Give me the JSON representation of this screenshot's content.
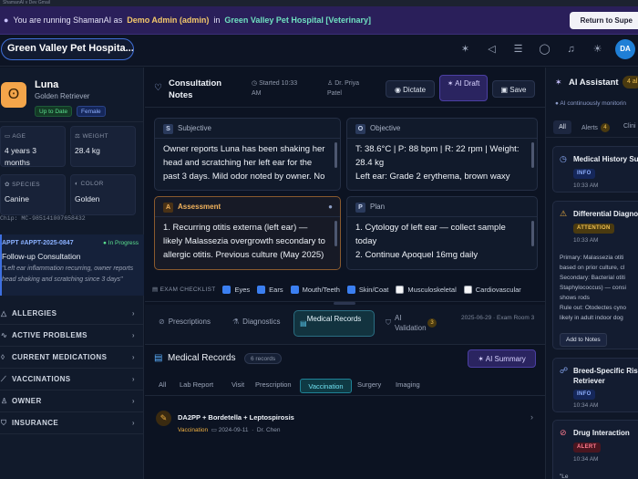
{
  "chrome": {
    "text": "ShamanAI v Dev    Gmail"
  },
  "banner": {
    "prefix": "You are running ShamanAI as",
    "user": "Demo Admin (admin)",
    "in": "in",
    "clinic": "Green Valley Pet Hospital [Veterinary]",
    "return": "Return to Supe"
  },
  "header": {
    "clinic_selector": "Green Valley Pet Hospita...",
    "avatar": "DA"
  },
  "pet": {
    "name": "Luna",
    "breed": "Golden Retriever",
    "status": "Up to Date",
    "sex": "Female",
    "stats": [
      {
        "label": "AGE",
        "value": "4 years 3 months"
      },
      {
        "label": "WEIGHT",
        "value": "28.4 kg"
      },
      {
        "label": "SPECIES",
        "value": "Canine"
      },
      {
        "label": "COLOR",
        "value": "Golden"
      }
    ],
    "chip": "Chip: MC-985141007658432"
  },
  "appointment": {
    "id": "APPT #APPT-2025-0847",
    "status": "● In Progress",
    "title": "Follow-up Consultation",
    "note": "\"Left ear inflammation recurring, owner reports head shaking and scratching since 3 days\""
  },
  "sections": [
    "ALLERGIES",
    "ACTIVE PROBLEMS",
    "CURRENT MEDICATIONS",
    "VACCINATIONS",
    "OWNER",
    "INSURANCE"
  ],
  "consult": {
    "title": "Consultation Notes",
    "started": "Started 10:33 AM",
    "doctor": "Dr. Priya Patel",
    "dictate": "Dictate",
    "ai_draft": "AI Draft",
    "save": "Save"
  },
  "soap": {
    "subjective": {
      "letter": "S",
      "title": "Subjective",
      "body": "Owner reports Luna has been shaking her head and scratching her left ear for the past 3 days. Mild odor noted by owner. No"
    },
    "objective": {
      "letter": "O",
      "title": "Objective",
      "body": "T: 38.6°C | P: 88 bpm | R: 22 rpm | Weight: 28.4 kg\nLeft ear: Grade 2 erythema, brown waxy"
    },
    "assessment": {
      "letter": "A",
      "title": "Assessment",
      "body": "1. Recurring otitis externa (left ear) — likely Malassezia overgrowth secondary to allergic otitis. Previous culture (May 2025)"
    },
    "plan": {
      "letter": "P",
      "title": "Plan",
      "body": "1. Cytology of left ear — collect sample today\n2. Continue Apoquel 16mg daily"
    }
  },
  "exam": {
    "label": "EXAM CHECKLIST",
    "items": [
      {
        "label": "Eyes",
        "checked": true
      },
      {
        "label": "Ears",
        "checked": true
      },
      {
        "label": "Mouth/Teeth",
        "checked": true
      },
      {
        "label": "Skin/Coat",
        "checked": true
      },
      {
        "label": "Musculoskeletal",
        "checked": false
      },
      {
        "label": "Cardiovascular",
        "checked": false
      }
    ]
  },
  "tabs": {
    "prescriptions": "Prescriptions",
    "diagnostics": "Diagnostics",
    "medical_records": "Medical Records",
    "ai_validation": "AI Validation",
    "ai_validation_count": "3",
    "exam_room": "2025-06-29 · Exam Room 3"
  },
  "records": {
    "title": "Medical Records",
    "count": "6 records",
    "ai_summary": "AI Summary",
    "filters": [
      "All",
      "Lab Report",
      "Visit",
      "Prescription",
      "Vaccination",
      "Surgery",
      "Imaging"
    ],
    "active_filter": "Vaccination",
    "items": [
      {
        "title": "DA2PP + Bordetella + Leptospirosis",
        "type": "Vaccination",
        "date": "2024-09-11",
        "doctor": "Dr. Chen"
      }
    ]
  },
  "assistant": {
    "title": "AI Assistant",
    "alerts_badge": "4 al",
    "monitoring": "AI continuously monitorin",
    "tabs": {
      "all": "All",
      "alerts": "Alerts",
      "alerts_count": "4",
      "clinical": "Clini"
    },
    "cards": [
      {
        "title": "Medical History Su",
        "tag": "INFO",
        "time": "10:33 AM"
      },
      {
        "title": "Differential Diagnos",
        "tag": "ATTENTION",
        "time": "10:33 AM",
        "body": [
          "Primary: Malassezia otiti",
          "based on prior culture, cl",
          "Secondary: Bacterial otiti",
          "Staphylococcus) — consi",
          "shows rods",
          "Rule out: Otodectes cyno",
          "likely in adult indoor dog"
        ],
        "action": "Add to Notes"
      },
      {
        "title": "Breed-Specific Ris",
        "title2": "Retriever",
        "tag": "INFO",
        "time": "10:34 AM"
      },
      {
        "title": "Drug Interaction",
        "tag": "ALERT",
        "time": "10:34 AM",
        "body": [
          "\"Le"
        ]
      }
    ]
  },
  "colors": {
    "accent": "#3b7ff0",
    "ai": "#4b3fa3",
    "warning": "#f0b040",
    "success": "#5be08f",
    "alert": "#ff7b8f"
  }
}
